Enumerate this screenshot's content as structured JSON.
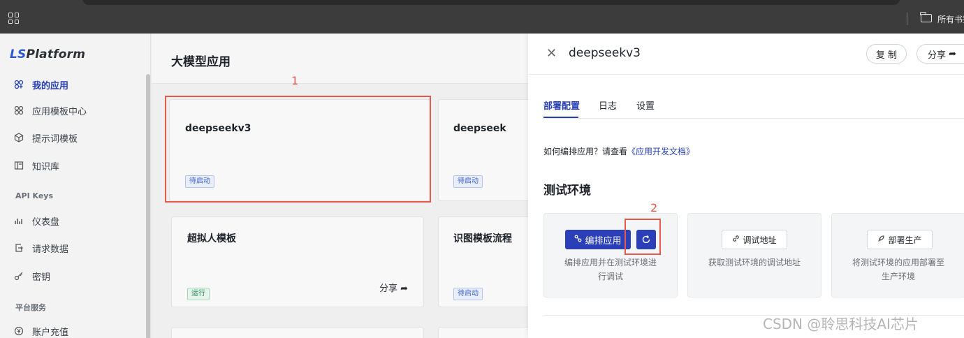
{
  "browser": {
    "bookmarks_label": "所有书签"
  },
  "sidebar": {
    "logo_prefix": "LS",
    "logo_suffix": "Platform",
    "items": [
      {
        "label": "我的应用"
      },
      {
        "label": "应用模板中心"
      },
      {
        "label": "提示词模板"
      },
      {
        "label": "知识库"
      }
    ],
    "group_api": "API Keys",
    "api_items": [
      {
        "label": "仪表盘"
      },
      {
        "label": "请求数据"
      },
      {
        "label": "密钥"
      }
    ],
    "group_platform": "平台服务",
    "platform_items": [
      {
        "label": "账户充值"
      }
    ]
  },
  "main": {
    "title": "大模型应用",
    "cards": [
      {
        "name": "deepseekv3",
        "status": "待启动"
      },
      {
        "name": "deepseek",
        "status": "待启动"
      },
      {
        "name": "超拟人模板",
        "status": "运行",
        "share": "分享"
      },
      {
        "name": "识图模板流程",
        "status": "待启动"
      }
    ]
  },
  "annotations": {
    "box1": "1",
    "box2": "2"
  },
  "drawer": {
    "title": "deepseekv3",
    "copy_label": "复 制",
    "share_label": "分享",
    "tabs": [
      {
        "label": "部署配置"
      },
      {
        "label": "日志"
      },
      {
        "label": "设置"
      }
    ],
    "hint_text": "如何编排应用？请查看",
    "hint_link": "《应用开发文档》",
    "section_title": "测试环境",
    "env_cards": [
      {
        "button": "编排应用",
        "desc": "编排应用并在测试环境进行调试"
      },
      {
        "button": "调试地址",
        "desc": "获取测试环境的调试地址"
      },
      {
        "button": "部署生产",
        "desc": "将测试环境的应用部署至生产环境"
      }
    ]
  },
  "watermark": "CSDN @聆思科技AI芯片",
  "colors": {
    "accent": "#263fb5",
    "annotation": "#e8594d"
  }
}
